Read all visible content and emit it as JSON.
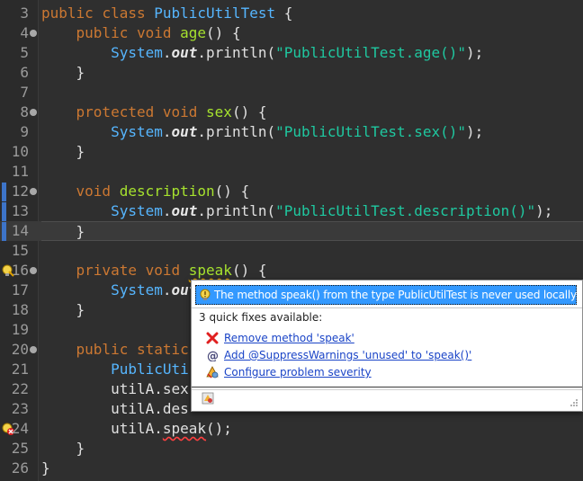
{
  "editor": {
    "lines": [
      {
        "num": "3",
        "tokens": [
          {
            "t": "public ",
            "c": "kw"
          },
          {
            "t": "class ",
            "c": "kw"
          },
          {
            "t": "PublicUtilTest",
            "c": "cls"
          },
          {
            "t": " {",
            "c": "fn"
          }
        ]
      },
      {
        "num": "4",
        "fold": true,
        "tokens": [
          {
            "t": "    public ",
            "c": "kw"
          },
          {
            "t": "void ",
            "c": "kw"
          },
          {
            "t": "age",
            "c": "meth"
          },
          {
            "t": "() {",
            "c": "fn"
          }
        ]
      },
      {
        "num": "5",
        "tokens": [
          {
            "t": "        System",
            "c": "cls"
          },
          {
            "t": ".",
            "c": "fn"
          },
          {
            "t": "out",
            "c": "ital"
          },
          {
            "t": ".println(",
            "c": "fn"
          },
          {
            "t": "\"PublicUtilTest.age()\"",
            "c": "str"
          },
          {
            "t": ");",
            "c": "fn"
          }
        ]
      },
      {
        "num": "6",
        "tokens": [
          {
            "t": "    }",
            "c": "fn"
          }
        ]
      },
      {
        "num": "7",
        "tokens": []
      },
      {
        "num": "8",
        "fold": true,
        "tokens": [
          {
            "t": "    protected ",
            "c": "kw"
          },
          {
            "t": "void ",
            "c": "kw"
          },
          {
            "t": "sex",
            "c": "meth"
          },
          {
            "t": "() {",
            "c": "fn"
          }
        ]
      },
      {
        "num": "9",
        "tokens": [
          {
            "t": "        System",
            "c": "cls"
          },
          {
            "t": ".",
            "c": "fn"
          },
          {
            "t": "out",
            "c": "ital"
          },
          {
            "t": ".println(",
            "c": "fn"
          },
          {
            "t": "\"PublicUtilTest.sex()\"",
            "c": "str"
          },
          {
            "t": ");",
            "c": "fn"
          }
        ]
      },
      {
        "num": "10",
        "tokens": [
          {
            "t": "    }",
            "c": "fn"
          }
        ]
      },
      {
        "num": "11",
        "tokens": []
      },
      {
        "num": "12",
        "fold": true,
        "blue": true,
        "tokens": [
          {
            "t": "    void ",
            "c": "kw"
          },
          {
            "t": "description",
            "c": "meth"
          },
          {
            "t": "() {",
            "c": "fn"
          }
        ]
      },
      {
        "num": "13",
        "blue": true,
        "tokens": [
          {
            "t": "        System",
            "c": "cls"
          },
          {
            "t": ".",
            "c": "fn"
          },
          {
            "t": "out",
            "c": "ital"
          },
          {
            "t": ".println(",
            "c": "fn"
          },
          {
            "t": "\"PublicUtilTest.description()\"",
            "c": "str"
          },
          {
            "t": ");",
            "c": "fn"
          }
        ]
      },
      {
        "num": "14",
        "blue": true,
        "current": true,
        "tokens": [
          {
            "t": "    }",
            "c": "fn"
          }
        ]
      },
      {
        "num": "15",
        "tokens": []
      },
      {
        "num": "16",
        "fold": true,
        "warn": true,
        "tokens": [
          {
            "t": "    private ",
            "c": "kw"
          },
          {
            "t": "void ",
            "c": "kw"
          },
          {
            "t": "speak",
            "c": "meth squiggle"
          },
          {
            "t": "() {",
            "c": "fn"
          }
        ]
      },
      {
        "num": "17",
        "tokens": [
          {
            "t": "        System",
            "c": "cls"
          },
          {
            "t": ".",
            "c": "fn"
          },
          {
            "t": "out",
            "c": "ital"
          }
        ]
      },
      {
        "num": "18",
        "tokens": [
          {
            "t": "    }",
            "c": "fn"
          }
        ]
      },
      {
        "num": "19",
        "tokens": []
      },
      {
        "num": "20",
        "fold": true,
        "tokens": [
          {
            "t": "    public ",
            "c": "kw"
          },
          {
            "t": "static",
            "c": "kw"
          }
        ]
      },
      {
        "num": "21",
        "tokens": [
          {
            "t": "        PublicUti",
            "c": "cls"
          }
        ]
      },
      {
        "num": "22",
        "tokens": [
          {
            "t": "        utilA.sex",
            "c": "fn"
          }
        ]
      },
      {
        "num": "23",
        "tokens": [
          {
            "t": "        utilA.des",
            "c": "fn"
          }
        ]
      },
      {
        "num": "24",
        "err": true,
        "tokens": [
          {
            "t": "        utilA.",
            "c": "fn"
          },
          {
            "t": "speak",
            "c": "fn squiggle-red"
          },
          {
            "t": "();",
            "c": "fn"
          }
        ]
      },
      {
        "num": "25",
        "tokens": [
          {
            "t": "    }",
            "c": "fn"
          }
        ]
      },
      {
        "num": "26",
        "tokens": [
          {
            "t": "}",
            "c": "fn"
          }
        ]
      }
    ]
  },
  "quickfix": {
    "header": "The method speak() from the type PublicUtilTest is never used locally",
    "count_label": "3 quick fixes available:",
    "items": [
      {
        "label": "Remove method 'speak'",
        "icon": "delete-icon"
      },
      {
        "label": "Add @SuppressWarnings 'unused' to 'speak()'",
        "icon": "annotation-icon"
      },
      {
        "label": "Configure problem severity",
        "icon": "configure-icon"
      }
    ]
  },
  "colors": {
    "background": "#2f2f2f",
    "keyword": "#cc7832",
    "class": "#56b6ff",
    "method": "#a6e22e",
    "string": "#1fc8a0",
    "popup_selection": "#3399ff",
    "link": "#1a44c7"
  }
}
